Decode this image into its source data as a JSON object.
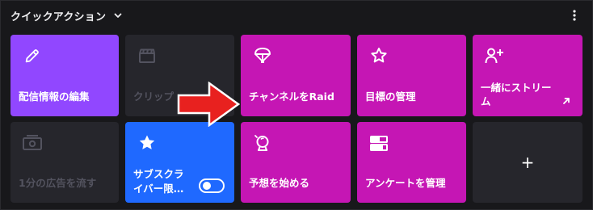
{
  "header": {
    "title": "クイックアクション",
    "chevron_icon": "chevron-down-icon",
    "more_icon": "more-vertical-icon"
  },
  "tiles": [
    {
      "label": "配信情報の編集",
      "icon": "pencil-icon",
      "color": "#9147ff",
      "enabled": true
    },
    {
      "label": "クリップ",
      "icon": "clapperboard-icon",
      "color": "#26262c",
      "enabled": false
    },
    {
      "label": "チャンネルをRaid",
      "icon": "parachute-icon",
      "color": "#c516b4",
      "enabled": true
    },
    {
      "label": "目標の管理",
      "icon": "star-icon",
      "color": "#c516b4",
      "enabled": true
    },
    {
      "label": "一緒にストリーム",
      "icon": "add-user-icon",
      "color": "#c516b4",
      "enabled": true,
      "external_icon": "external-link-icon"
    },
    {
      "label": "1分の広告を流す",
      "icon": "ad-icon",
      "color": "#26262c",
      "enabled": false
    },
    {
      "label": "サブスクライバー限…",
      "icon": "star-filled-icon",
      "color": "#1f69ff",
      "enabled": true,
      "toggle": "off"
    },
    {
      "label": "予想を始める",
      "icon": "prediction-icon",
      "color": "#c516b4",
      "enabled": true
    },
    {
      "label": "アンケートを管理",
      "icon": "poll-icon",
      "color": "#c516b4",
      "enabled": true
    },
    {
      "label": "+",
      "icon": "plus-icon",
      "color": "#26262c",
      "enabled": true
    }
  ],
  "annotation": {
    "arrow_icon": "red-arrow-icon",
    "arrow_color": "#e8211f"
  }
}
